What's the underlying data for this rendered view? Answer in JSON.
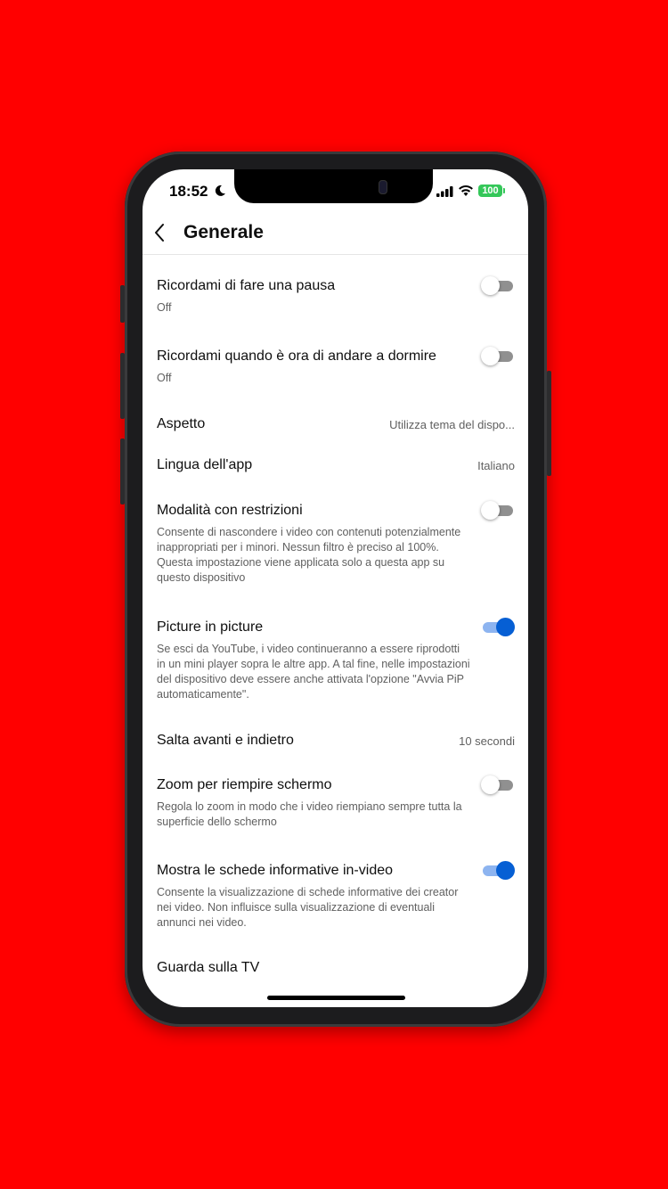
{
  "status": {
    "time": "18:52",
    "battery": "100"
  },
  "header": {
    "title": "Generale"
  },
  "settings": [
    {
      "label": "Ricordami di fare una pausa",
      "sub": "Off",
      "toggle": "off"
    },
    {
      "label": "Ricordami quando è ora di andare a dormire",
      "sub": "Off",
      "toggle": "off"
    },
    {
      "label": "Aspetto",
      "value": "Utilizza tema del dispo..."
    },
    {
      "label": "Lingua dell'app",
      "value": "Italiano"
    },
    {
      "label": "Modalità con restrizioni",
      "sub": "Consente di nascondere i video con contenuti potenzialmente inappropriati per i minori. Nessun filtro è preciso al 100%. Questa impostazione viene applicata solo a questa app su questo dispositivo",
      "toggle": "off"
    },
    {
      "label": "Picture in picture",
      "sub": "Se esci da YouTube, i video continueranno a essere riprodotti in un mini player sopra le altre app. A tal fine, nelle impostazioni del dispositivo deve essere anche attivata l'opzione \"Avvia PiP automaticamente\".",
      "toggle": "on"
    },
    {
      "label": "Salta avanti e indietro",
      "value": "10 secondi"
    },
    {
      "label": "Zoom per riempire schermo",
      "sub": "Regola lo zoom in modo che i video riempiano sempre tutta la superficie dello schermo",
      "toggle": "off"
    },
    {
      "label": "Mostra le schede informative in-video",
      "sub": "Consente la visualizzazione di schede informative dei creator nei video. Non influisce sulla visualizzazione di eventuali annunci nei video.",
      "toggle": "on"
    },
    {
      "label": "Guarda sulla TV"
    }
  ],
  "colors": {
    "background": "#ff0000",
    "toggle_on": "#065fd4",
    "battery": "#34c759"
  },
  "icons": {
    "back": "chevron-left-icon",
    "moon": "moon-icon",
    "signal": "signal-icon",
    "wifi": "wifi-icon"
  }
}
